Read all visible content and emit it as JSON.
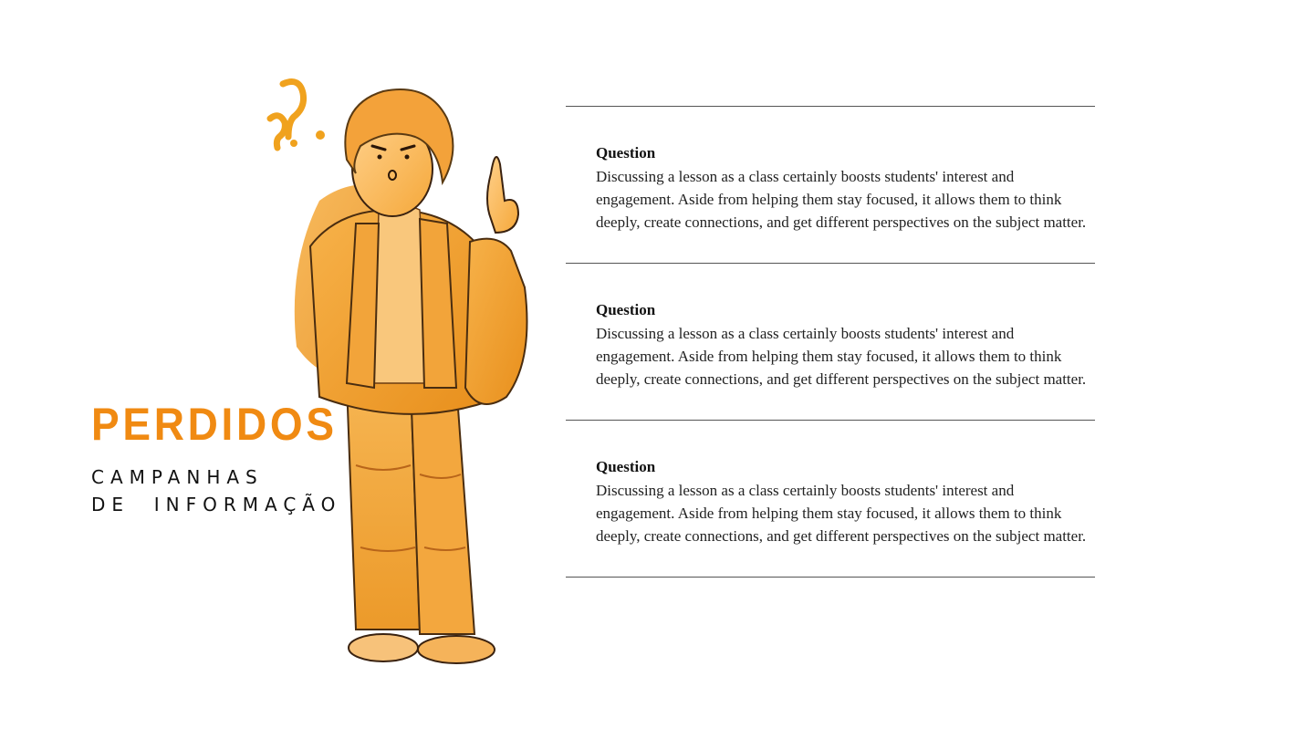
{
  "brand": {
    "title": "PERDIDOS",
    "subtitle_line1": "CAMPANHAS",
    "subtitle_line2": "DE  INFORMAÇÃO",
    "accent_color": "#f08a12"
  },
  "illustration": {
    "icon": "person-thinking-illustration",
    "decor": "question-marks"
  },
  "questions": [
    {
      "title": "Question",
      "body": "Discussing a lesson as a class certainly boosts students' interest and engagement. Aside from helping them stay focused, it allows them to think deeply, create connections, and get different perspectives on the subject matter."
    },
    {
      "title": "Question",
      "body": "Discussing a lesson as a class certainly boosts students' interest and engagement. Aside from helping them stay focused, it allows them to think deeply, create connections, and get different perspectives on the subject matter."
    },
    {
      "title": "Question",
      "body": "Discussing a lesson as a class certainly boosts students' interest and engagement. Aside from helping them stay focused, it allows them to think deeply, create connections, and get different perspectives on the subject matter."
    }
  ]
}
